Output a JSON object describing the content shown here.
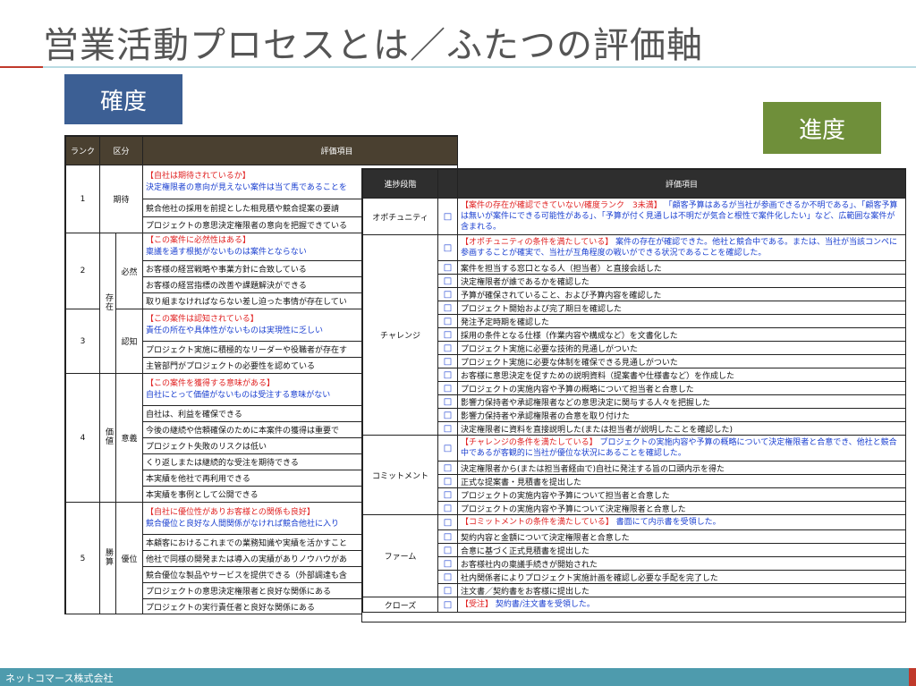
{
  "slide": {
    "title": "営業活動プロセスとは／ふたつの評価軸",
    "label_certainty": "確度",
    "label_progress": "進度",
    "footer": "ネットコマース株式会社"
  },
  "certainty_table": {
    "headers": {
      "rank": "ランク",
      "category": "区分",
      "items": "評価項目"
    },
    "group_labels": {
      "existence": "存在",
      "value": "価値",
      "victory": "勝算"
    },
    "ranks": [
      {
        "rank": "1",
        "sub": "期待",
        "head_red": "【自社は期待されているか】",
        "head_blue": "決定権限者の意向が見えない案件は当て馬であることを",
        "items": [
          "競合他社の採用を前提とした相見積や競合提案の要請",
          "プロジェクトの意思決定権限者の意向を把握できている"
        ]
      },
      {
        "rank": "2",
        "sub": "必然",
        "head_red": "【この案件に必然性はある】",
        "head_blue": "稟議を通す根拠がないものは案件とならない",
        "items": [
          "お客様の経営戦略や事業方針に合致している",
          "お客様の経営指標の改善や課題解決ができる",
          "取り組まなければならない差し迫った事情が存在してい"
        ]
      },
      {
        "rank": "3",
        "sub": "認知",
        "head_red": "【この案件は認知されている】",
        "head_blue": "責任の所在や具体性がないものは実現性に乏しい",
        "items": [
          "プロジェクト実施に積極的なリーダーや役職者が存在す",
          "主管部門がプロジェクトの必要性を認めている"
        ]
      },
      {
        "rank": "4",
        "sub": "意義",
        "head_red": "【この案件を獲得する意味がある】",
        "head_blue": "自社にとって価値がないものは受注する意味がない",
        "items": [
          "自社は、利益を確保できる",
          "今後の継続や信頼確保のために本案件の獲得は重要で",
          "プロジェクト失敗のリスクは低い",
          "くり返しまたは継続的な受注を期待できる",
          "本実績を他社で再利用できる",
          "本実績を事例として公開できる"
        ]
      },
      {
        "rank": "5",
        "sub": "優位",
        "head_red": "【自社に優位性がありお客様との関係も良好】",
        "head_blue": "競合優位と良好な人間関係がなければ競合他社に入り",
        "items": [
          "本顧客におけるこれまでの業務知識や実績を活かすこと",
          "他社で同様の開発または導入の実績がありノウハウがあ",
          "競合優位な製品やサービスを提供できる（外部調達も含",
          "プロジェクトの意思決定権限者と良好な関係にある",
          "プロジェクトの実行責任者と良好な関係にある"
        ]
      }
    ]
  },
  "progress_table": {
    "headers": {
      "stage": "進捗段階",
      "items": "評価項目"
    },
    "checkbox_glyph": "□",
    "stages": [
      {
        "name": "オポチュニティ",
        "head_red": "【案件の存在が確認できていない/確度ランク　3未満】",
        "head_blue": "「顧客予算はあるが当社が参画できるか不明である」、「顧客予算は無いが案件にできる可能性がある」、「予算が付く見通しは不明だが気合と根性で案件化したい」など、広範囲な案件が含まれる。",
        "items": []
      },
      {
        "name": "チャレンジ",
        "head_red": "【オポチュニティの条件を満たしている】",
        "head_blue": "案件の存在が確認できた。他社と競合中である。または、当社が当該コンペに参画することが確実で、当社が互角程度の戦いができる状況であることを確認した。",
        "items": [
          "案件を担当する窓口となる人（担当者）と直接会話した",
          "決定権限者が誰であるかを確認した",
          "予算が確保されていること、および予算内容を確認した",
          "プロジェクト開始および完了期日を確認した",
          "発注予定時期を確認した",
          "採用の条件となる仕様（作業内容や構成など）を文書化した",
          "プロジェクト実施に必要な技術的見通しがついた",
          "プロジェクト実施に必要な体制を確保できる見通しがついた",
          "お客様に意思決定を促すための説明資料（提案書や仕様書など）を作成した",
          "プロジェクトの実施内容や予算の概略について担当者と合意した",
          "影響力保持者や承認権限者などの意思決定に関与する人々を把握した",
          "影響力保持者や承認権限者の合意を取り付けた",
          "決定権限者に資料を直接説明した(または担当者が説明したことを確認した)"
        ]
      },
      {
        "name": "コミットメント",
        "head_red": "【チャレンジの条件を満たしている】",
        "head_blue": "プロジェクトの実施内容や予算の概略について決定権限者と合意でき、他社と競合中であるが客観的に当社が優位な状況にあることを確認した。",
        "items": [
          "決定権限者から(または担当者経由で)自社に発注する旨の口頭内示を得た",
          "正式な提案書・見積書を提出した",
          "プロジェクトの実施内容や予算について担当者と合意した",
          "プロジェクトの実施内容や予算について決定権限者と合意した"
        ]
      },
      {
        "name": "ファーム",
        "head_red": "【コミットメントの条件を満たしている】",
        "head_blue": "書面にて内示書を受領した。",
        "items": [
          "契約内容と金額について決定権限者と合意した",
          "合意に基づく正式見積書を提出した",
          "お客様社内の稟議手続きが開始された",
          "社内関係者によりプロジェクト実施計画を確認し必要な手配を完了した",
          "注文書／契約書をお客様に提出した"
        ]
      },
      {
        "name": "クローズ",
        "head_red": "【受注】",
        "head_blue": "契約書/注文書を受領した。",
        "items": []
      }
    ]
  }
}
